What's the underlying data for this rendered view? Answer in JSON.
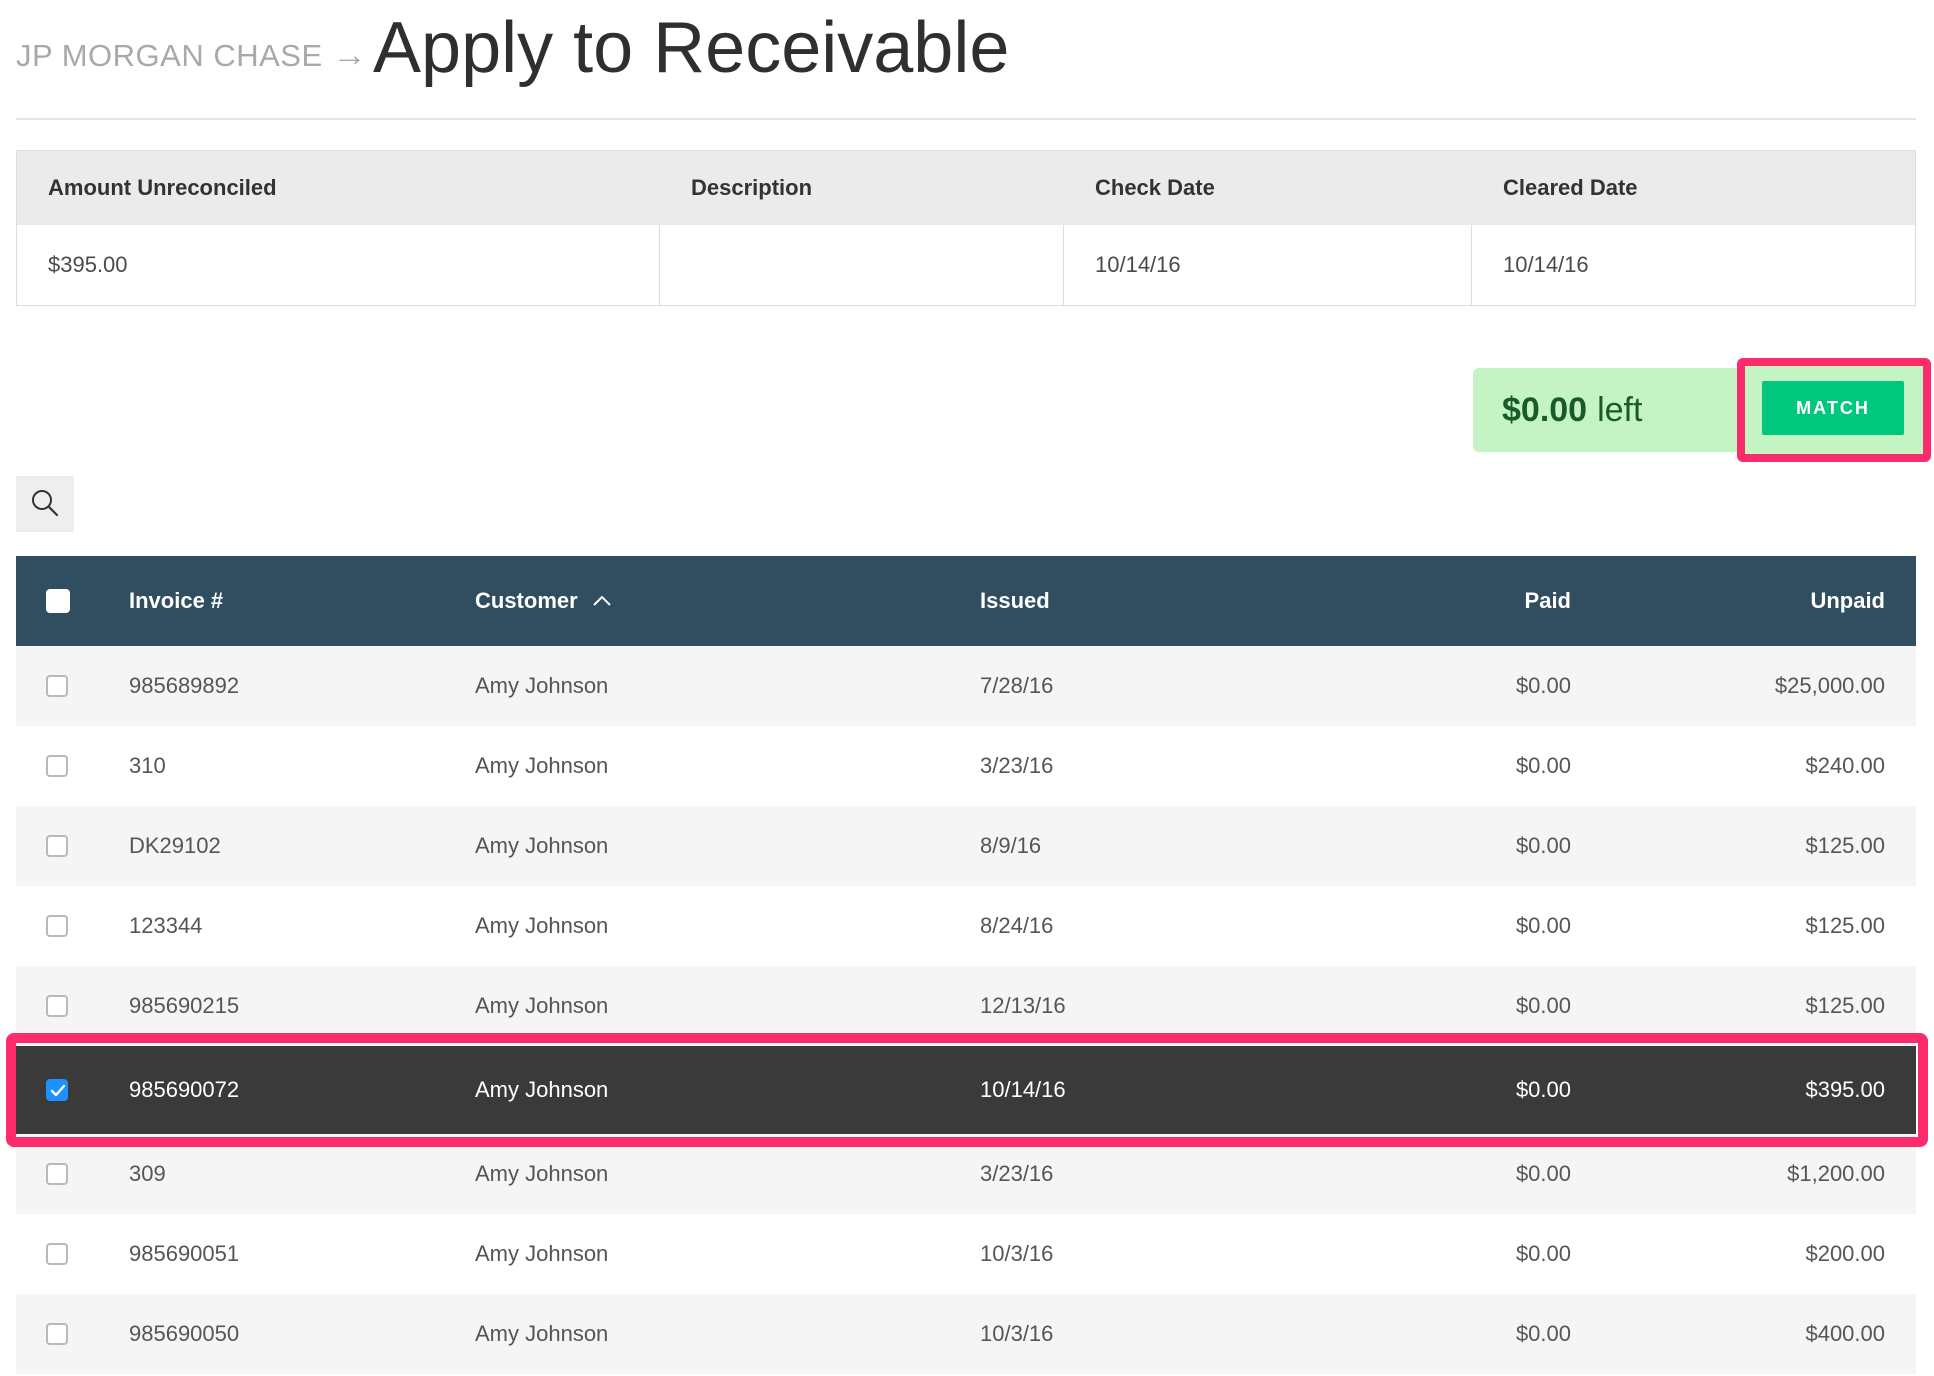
{
  "header": {
    "breadcrumb": "JP MORGAN CHASE",
    "breadcrumb_arrow": "→",
    "title": "Apply to Receivable"
  },
  "summary": {
    "headers": [
      "Amount Unreconciled",
      "Description",
      "Check Date",
      "Cleared Date"
    ],
    "values": [
      "$395.00",
      "",
      "10/14/16",
      "10/14/16"
    ]
  },
  "balance": {
    "amount": "$0.00",
    "suffix": "left"
  },
  "match_button": "MATCH",
  "invoices": {
    "headers": {
      "invoice": "Invoice #",
      "customer": "Customer",
      "issued": "Issued",
      "paid": "Paid",
      "unpaid": "Unpaid"
    },
    "sort": {
      "column": "customer",
      "direction": "ascending"
    },
    "rows": [
      {
        "invoice": "985689892",
        "customer": "Amy Johnson",
        "issued": "7/28/16",
        "paid": "$0.00",
        "unpaid": "$25,000.00",
        "checked": false
      },
      {
        "invoice": "310",
        "customer": "Amy Johnson",
        "issued": "3/23/16",
        "paid": "$0.00",
        "unpaid": "$240.00",
        "checked": false
      },
      {
        "invoice": "DK29102",
        "customer": "Amy Johnson",
        "issued": "8/9/16",
        "paid": "$0.00",
        "unpaid": "$125.00",
        "checked": false
      },
      {
        "invoice": "123344",
        "customer": "Amy Johnson",
        "issued": "8/24/16",
        "paid": "$0.00",
        "unpaid": "$125.00",
        "checked": false
      },
      {
        "invoice": "985690215",
        "customer": "Amy Johnson",
        "issued": "12/13/16",
        "paid": "$0.00",
        "unpaid": "$125.00",
        "checked": false
      },
      {
        "invoice": "985690072",
        "customer": "Amy Johnson",
        "issued": "10/14/16",
        "paid": "$0.00",
        "unpaid": "$395.00",
        "checked": true
      },
      {
        "invoice": "309",
        "customer": "Amy Johnson",
        "issued": "3/23/16",
        "paid": "$0.00",
        "unpaid": "$1,200.00",
        "checked": false
      },
      {
        "invoice": "985690051",
        "customer": "Amy Johnson",
        "issued": "10/3/16",
        "paid": "$0.00",
        "unpaid": "$200.00",
        "checked": false
      },
      {
        "invoice": "985690050",
        "customer": "Amy Johnson",
        "issued": "10/3/16",
        "paid": "$0.00",
        "unpaid": "$400.00",
        "checked": false
      }
    ]
  },
  "colors": {
    "header_bar": "#304e60",
    "selected_row": "#3a3a3a",
    "highlight": "#fc2c6c",
    "match_button": "#00c77e",
    "balance_pill": "#c4f3c4",
    "checkbox_checked": "#1e90ff"
  },
  "icons": {
    "search": "search-icon",
    "sort": "chevron-up-icon",
    "check": "check-icon"
  }
}
